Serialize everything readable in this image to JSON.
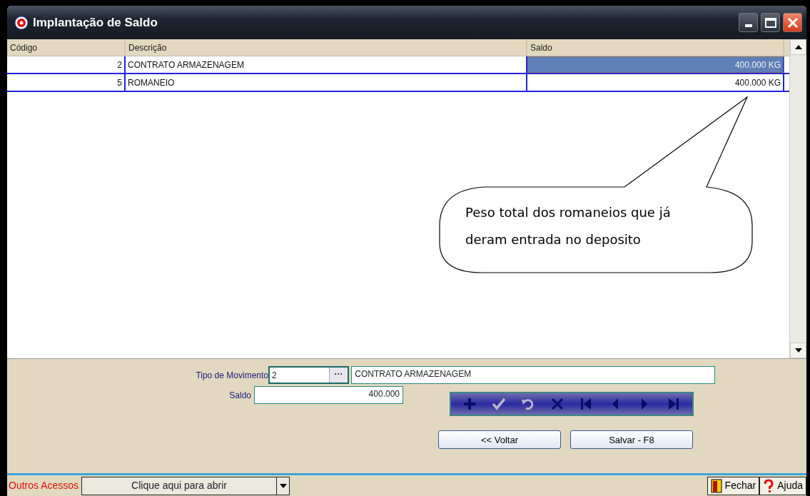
{
  "window": {
    "title": "Implantação de Saldo"
  },
  "table": {
    "columns": [
      "Código",
      "Descrição",
      "Saldo"
    ],
    "rows": [
      {
        "codigo": "2",
        "descricao": "CONTRATO ARMAZENAGEM",
        "saldo": "400.000 KG",
        "selected": true
      },
      {
        "codigo": "5",
        "descricao": "ROMANEIO",
        "saldo": "400.000 KG",
        "selected": false
      }
    ]
  },
  "callout": {
    "text": "Peso total dos romaneios que já deram entrada no deposito"
  },
  "form": {
    "tipo_label": "Tipo de Movimento",
    "tipo_value": "2",
    "tipo_button": "···",
    "tipo_description": "CONTRATO ARMAZENAGEM",
    "saldo_label": "Saldo",
    "saldo_value": "400.000"
  },
  "navigator": [
    {
      "kind": "add",
      "disabled": false
    },
    {
      "kind": "confirm",
      "disabled": true
    },
    {
      "kind": "undo",
      "disabled": true
    },
    {
      "kind": "delete",
      "disabled": false
    },
    {
      "kind": "first",
      "disabled": false
    },
    {
      "kind": "prior",
      "disabled": false
    },
    {
      "kind": "next",
      "disabled": false
    },
    {
      "kind": "last",
      "disabled": false
    }
  ],
  "buttons": [
    "<< Voltar",
    "Salvar - F8"
  ],
  "footer": {
    "label": "Outros Acessos",
    "dropdown": "Clique aqui para abrir",
    "close": "Fechar",
    "help": "Ajuda"
  }
}
